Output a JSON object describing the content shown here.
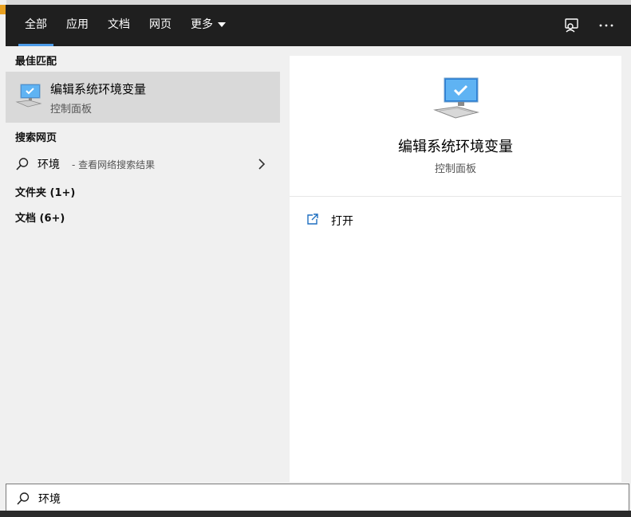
{
  "tabs": [
    {
      "label": "全部",
      "active": true
    },
    {
      "label": "应用"
    },
    {
      "label": "文档"
    },
    {
      "label": "网页"
    },
    {
      "label": "更多"
    }
  ],
  "sections": {
    "best_match": "最佳匹配",
    "search_web": "搜索网页",
    "folders": "文件夹 (1+)",
    "documents": "文档 (6+)"
  },
  "best_match_item": {
    "title": "编辑系统环境变量",
    "subtitle": "控制面板",
    "icon": "computer-monitor-icon"
  },
  "web_result": {
    "query": "环境",
    "hint": "- 查看网络搜索结果"
  },
  "preview": {
    "title": "编辑系统环境变量",
    "subtitle": "控制面板",
    "action_open": "打开"
  },
  "search": {
    "value": "环境"
  },
  "colors": {
    "topbar": "#1f1f1f",
    "accent": "#4c9be8",
    "selected": "#d9d9d9"
  }
}
